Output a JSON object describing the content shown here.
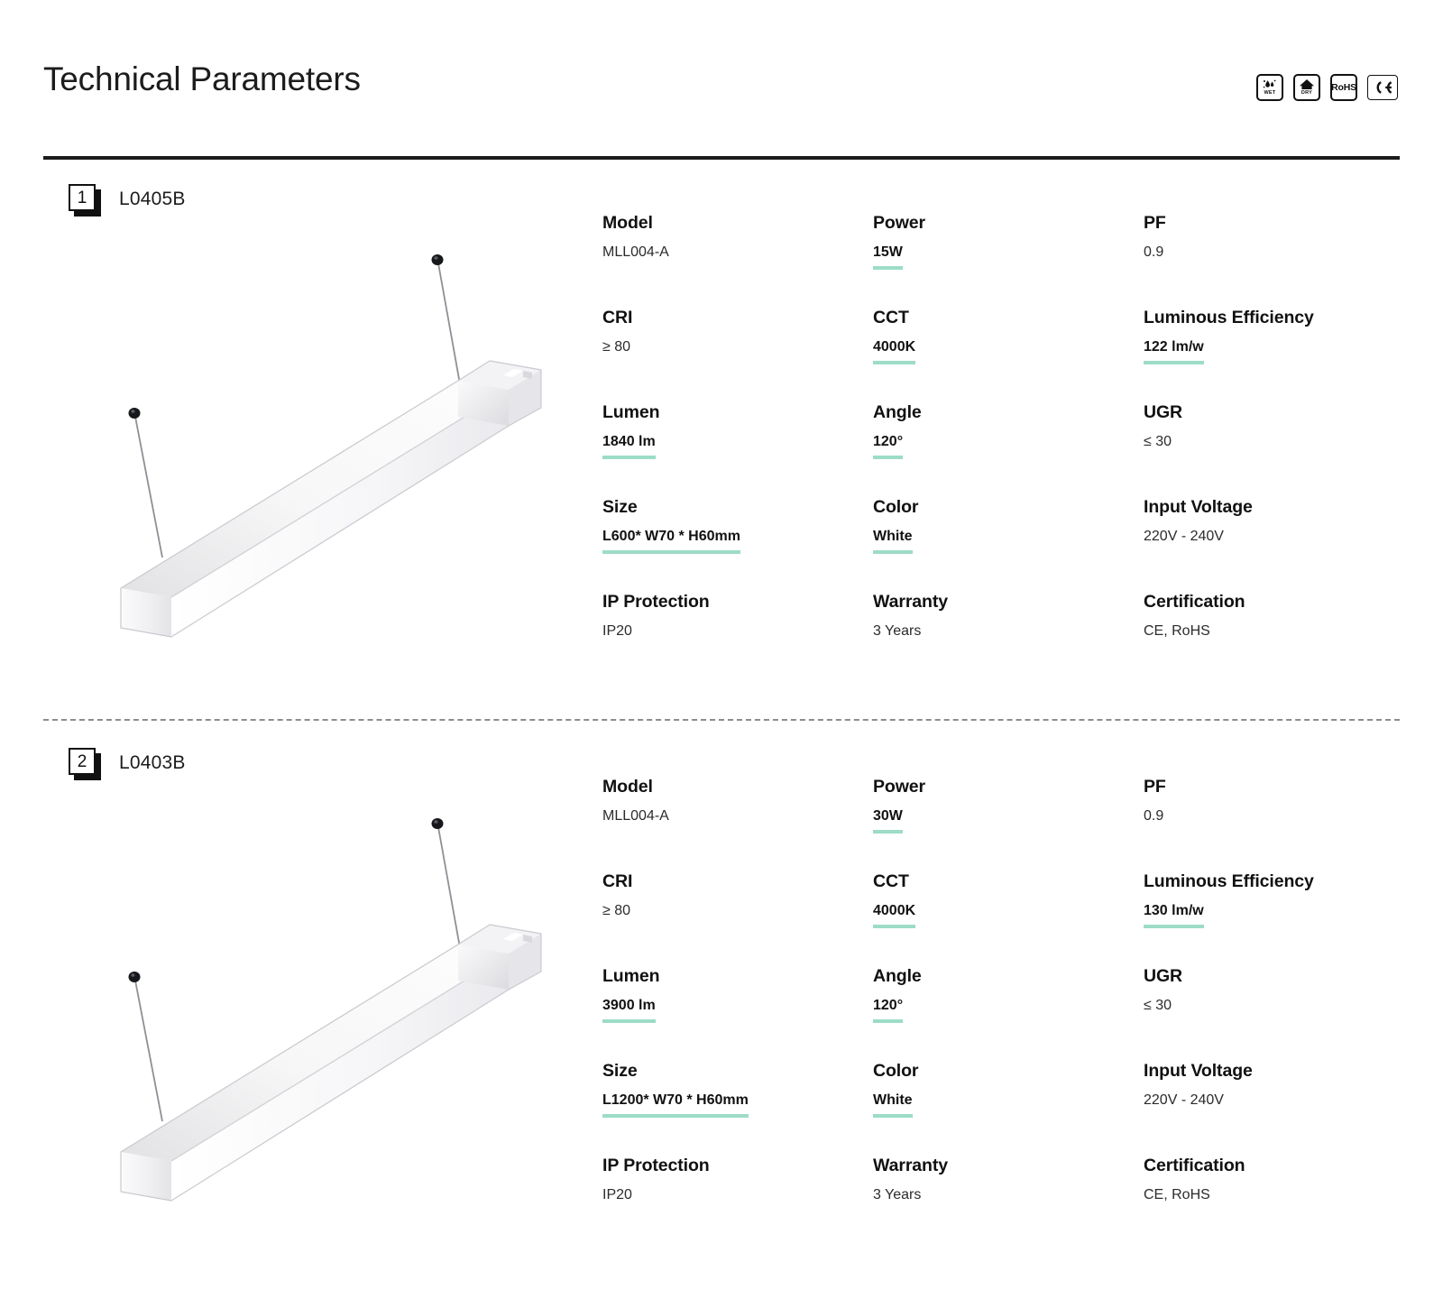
{
  "header": {
    "title": "Technical Parameters",
    "certifications": [
      {
        "name": "wet-location-icon",
        "caption": "WET",
        "kind": "wet"
      },
      {
        "name": "dry-location-icon",
        "caption": "DRY",
        "kind": "dry"
      },
      {
        "name": "rohs-icon",
        "caption": "RoHS",
        "kind": "text"
      },
      {
        "name": "ce-mark-icon",
        "caption": "CE",
        "kind": "ce"
      }
    ]
  },
  "theme": {
    "highlight": "#9ddcc6",
    "ink": "#1c1c1c",
    "rule": "#1c1c1c"
  },
  "products": [
    {
      "index": "1",
      "code": "L0405B",
      "image_alt": "white suspended linear LED pendant luminaire on two steel cables",
      "specs": [
        {
          "label": "Model",
          "value": "MLL004-A",
          "highlight": false
        },
        {
          "label": "Power",
          "value": "15W",
          "highlight": true
        },
        {
          "label": "PF",
          "value": "0.9",
          "highlight": false
        },
        {
          "label": "CRI",
          "value": "≥ 80",
          "highlight": false
        },
        {
          "label": "CCT",
          "value": "4000K",
          "highlight": true
        },
        {
          "label": "Luminous Efficiency",
          "value": "122 lm/w",
          "highlight": true
        },
        {
          "label": "Lumen",
          "value": "1840 lm",
          "highlight": true
        },
        {
          "label": "Angle",
          "value": "120°",
          "highlight": true
        },
        {
          "label": "UGR",
          "value": "≤ 30",
          "highlight": false
        },
        {
          "label": "Size",
          "value": "L600* W70 * H60mm",
          "highlight": true
        },
        {
          "label": "Color",
          "value": "White",
          "highlight": true
        },
        {
          "label": "Input Voltage",
          "value": "220V - 240V",
          "highlight": false
        },
        {
          "label": "IP Protection",
          "value": "IP20",
          "highlight": false
        },
        {
          "label": "Warranty",
          "value": "3 Years",
          "highlight": false
        },
        {
          "label": "Certification",
          "value": "CE, RoHS",
          "highlight": false
        }
      ]
    },
    {
      "index": "2",
      "code": "L0403B",
      "image_alt": "white suspended linear LED pendant luminaire on two steel cables",
      "specs": [
        {
          "label": "Model",
          "value": "MLL004-A",
          "highlight": false
        },
        {
          "label": "Power",
          "value": "30W",
          "highlight": true
        },
        {
          "label": "PF",
          "value": "0.9",
          "highlight": false
        },
        {
          "label": "CRI",
          "value": "≥ 80",
          "highlight": false
        },
        {
          "label": "CCT",
          "value": "4000K",
          "highlight": true
        },
        {
          "label": "Luminous Efficiency",
          "value": "130 lm/w",
          "highlight": true
        },
        {
          "label": "Lumen",
          "value": "3900 lm",
          "highlight": true
        },
        {
          "label": "Angle",
          "value": "120°",
          "highlight": true
        },
        {
          "label": "UGR",
          "value": "≤ 30",
          "highlight": false
        },
        {
          "label": "Size",
          "value": "L1200* W70 * H60mm",
          "highlight": true
        },
        {
          "label": "Color",
          "value": "White",
          "highlight": true
        },
        {
          "label": "Input Voltage",
          "value": "220V - 240V",
          "highlight": false
        },
        {
          "label": "IP Protection",
          "value": "IP20",
          "highlight": false
        },
        {
          "label": "Warranty",
          "value": "3 Years",
          "highlight": false
        },
        {
          "label": "Certification",
          "value": "CE, RoHS",
          "highlight": false
        }
      ]
    }
  ]
}
